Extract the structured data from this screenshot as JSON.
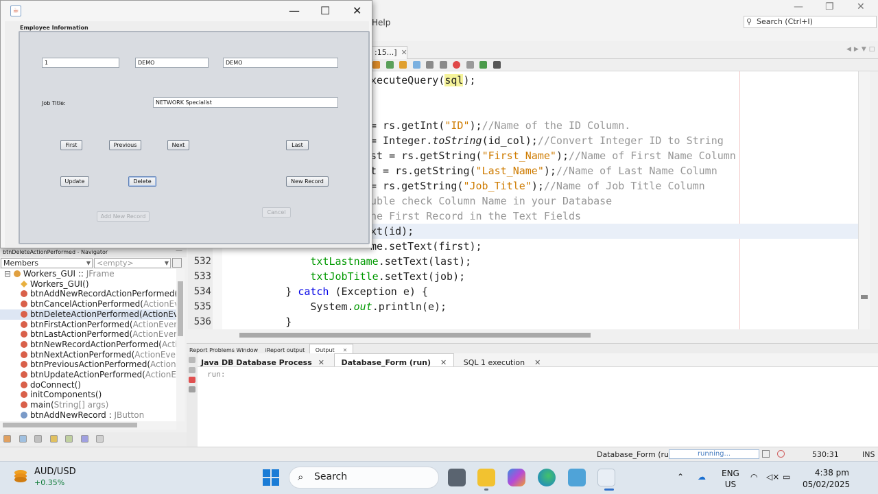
{
  "ide": {
    "menu_help": "Help",
    "search_placeholder": "Search (Ctrl+I)",
    "editor_tab": ":15...]",
    "status": {
      "process": "Database_Form (run)",
      "progress": "running...",
      "position": "530:31",
      "mode": "INS"
    }
  },
  "code": {
    "lines": [
      {
        "n": "",
        "hl": false,
        "html": "xecuteQuery(<span class=\"selw\">sql</span>);"
      },
      {
        "n": "",
        "hl": false,
        "html": ""
      },
      {
        "n": "",
        "hl": false,
        "html": ""
      },
      {
        "n": "",
        "hl": false,
        "html": "= rs.getInt(<span class=\"str\">\"ID\"</span>);<span class=\"cmt\">//Name of the ID Column.</span>"
      },
      {
        "n": "",
        "hl": false,
        "html": "= Integer.<span class=\"ita\">toString</span>(id_col);<span class=\"cmt\">//Convert Integer ID to String</span>"
      },
      {
        "n": "",
        "hl": false,
        "html": "st = rs.getString(<span class=\"str\">\"First_Name\"</span>);<span class=\"cmt\">//Name of First Name Column</span>"
      },
      {
        "n": "",
        "hl": false,
        "html": "t = rs.getString(<span class=\"str\">\"Last_Name\"</span>);<span class=\"cmt\">//Name of Last Name Column</span>"
      },
      {
        "n": "",
        "hl": false,
        "html": "= rs.getString(<span class=\"str\">\"Job_Title\"</span>);<span class=\"cmt\">//Name of Job Title Column</span>"
      },
      {
        "n": "",
        "hl": false,
        "html": "<span class=\"cmt\">uble check Column Name in your Database</span>"
      },
      {
        "n": "",
        "hl": false,
        "html": "<span class=\"cmt\">he First Record in the Text Fields</span>"
      },
      {
        "n": "",
        "hl": true,
        "html": "xt(id);"
      },
      {
        "n": "",
        "hl": false,
        "html": "me.setText(first);"
      },
      {
        "n": "532",
        "hl": false,
        "html": "            <span class=\"fld\">txtLastname</span>.setText(last);"
      },
      {
        "n": "533",
        "hl": false,
        "html": "            <span class=\"fld\">txtJobTitle</span>.setText(job);"
      },
      {
        "n": "534",
        "hl": false,
        "html": "        } <span class=\"kw\">catch</span> (Exception e) {"
      },
      {
        "n": "535",
        "hl": false,
        "html": "            System.<span class=\"fld ita\">out</span>.println(e);"
      },
      {
        "n": "536",
        "hl": false,
        "html": "        }"
      }
    ]
  },
  "output": {
    "tabs": [
      "Report Problems Window",
      "iReport output",
      "Output"
    ],
    "process_tabs": [
      "Java DB Database Process",
      "Database_Form (run)",
      "SQL 1 execution"
    ],
    "text": "run:"
  },
  "navigator": {
    "title": "btnDeleteActionPerformed - Navigator",
    "filter": "Members",
    "filter2": "<empty>",
    "items": [
      {
        "name": "Workers_GUI :: ",
        "type": "JFrame",
        "icon": "class-icon"
      },
      {
        "name": "Workers_GUI()",
        "type": "",
        "icon": "constructor-icon"
      },
      {
        "name": "btnAddNewRecordActionPerformed(",
        "type": "ActionE",
        "icon": "method-icon"
      },
      {
        "name": "btnCancelActionPerformed(",
        "type": "ActionEvent evt)",
        "icon": "method-icon"
      },
      {
        "name": "btnDeleteActionPerformed(ActionEvent evt)",
        "type": "",
        "icon": "method-icon"
      },
      {
        "name": "btnFirstActionPerformed(",
        "type": "ActionEvent evt)",
        "icon": "method-icon"
      },
      {
        "name": "btnLastActionPerformed(",
        "type": "ActionEvent evt)",
        "icon": "method-icon"
      },
      {
        "name": "btnNewRecordActionPerformed(",
        "type": "ActionEvent",
        "icon": "method-icon"
      },
      {
        "name": "btnNextActionPerformed(",
        "type": "ActionEvent evt)",
        "icon": "method-icon"
      },
      {
        "name": "btnPreviousActionPerformed(",
        "type": "ActionEvent ev",
        "icon": "method-icon"
      },
      {
        "name": "btnUpdateActionPerformed(",
        "type": "ActionEvent evt",
        "icon": "method-icon"
      },
      {
        "name": "doConnect()",
        "type": "",
        "icon": "method-icon"
      },
      {
        "name": "initComponents()",
        "type": "",
        "icon": "method-icon"
      },
      {
        "name": "main(",
        "type": "String[] args)",
        "icon": "method-icon"
      },
      {
        "name": "btnAddNewRecord : ",
        "type": "JButton",
        "icon": "field-icon"
      }
    ]
  },
  "dialog": {
    "panel_title": "Employee Information",
    "id_value": "1",
    "first_value": "DEMO",
    "last_value": "DEMO",
    "job_label": "Job Title:",
    "job_value": "NETWORK Specialist",
    "buttons": {
      "first": "First",
      "previous": "Previous",
      "next": "Next",
      "last": "Last",
      "update": "Update",
      "delete": "Delete",
      "new_record": "New Record",
      "add_new_record": "Add New Record",
      "cancel": "Cancel"
    }
  },
  "taskbar": {
    "ticker_name": "AUD/USD",
    "ticker_change": "+0.35%",
    "search": "Search",
    "lang1": "ENG",
    "lang2": "US",
    "time": "4:38 pm",
    "date": "05/02/2025"
  }
}
